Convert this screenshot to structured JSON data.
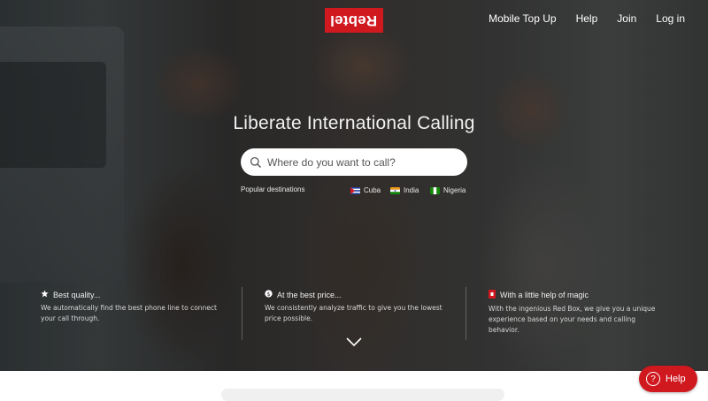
{
  "brand": {
    "logo_text": "Rebtel",
    "accent_color": "#d0181f"
  },
  "nav": {
    "items": [
      {
        "label": "Mobile Top Up"
      },
      {
        "label": "Help"
      },
      {
        "label": "Join"
      },
      {
        "label": "Log in"
      }
    ]
  },
  "hero": {
    "headline": "Liberate International Calling",
    "search": {
      "placeholder": "Where do you want to call?",
      "icon": "search-icon"
    },
    "popular_label": "Popular destinations",
    "destinations": [
      {
        "label": "Cuba",
        "icon": "cuba-flag-icon"
      },
      {
        "label": "India",
        "icon": "india-flag-icon"
      },
      {
        "label": "Nigeria",
        "icon": "nigeria-flag-icon"
      }
    ]
  },
  "features": [
    {
      "title": "Best quality...",
      "icon": "star-icon",
      "desc": "We automatically find the best phone line to connect your call through."
    },
    {
      "title": "At the best price...",
      "icon": "price-icon",
      "desc": "We consistently analyze traffic to give you the lowest price possible."
    },
    {
      "title": "With a little help of magic",
      "icon": "red-box-icon",
      "desc": "With the ingenious Red Box, we give you a unique experience based on your needs and calling behavior."
    }
  ],
  "scroll_down": {
    "icon": "chevron-down-icon"
  },
  "help_button": {
    "label": "Help",
    "icon": "question-icon"
  }
}
